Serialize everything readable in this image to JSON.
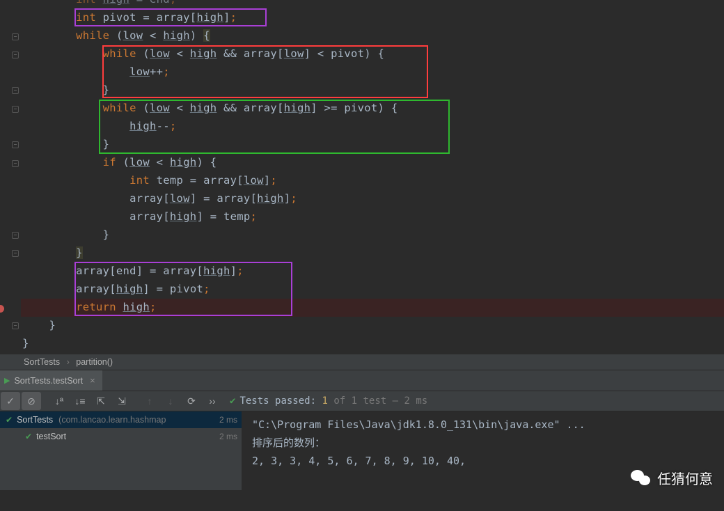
{
  "code": {
    "l1": "int high = end;",
    "l1_kw": "int ",
    "l1_var": "high",
    "l1_rest": " = end",
    "l2_kw": "int ",
    "l2_rest1": "pivot = array[",
    "l2_high": "high",
    "l2_rest2": "]",
    "l3_kw": "while ",
    "l3_rest1": "(",
    "l3_low": "low",
    "l3_rest2": " < ",
    "l3_high": "high",
    "l3_rest3": ") ",
    "l3_brace": "{",
    "l4_kw": "while ",
    "l4_rest1": "(",
    "l4_low": "low",
    "l4_rest2": " < ",
    "l4_high": "high",
    "l4_rest3": " && array[",
    "l4_low2": "low",
    "l4_rest4": "] < pivot) {",
    "l5_low": "low",
    "l5_rest": "++",
    "l6": "}",
    "l7_kw": "while ",
    "l7_rest1": "(",
    "l7_low": "low",
    "l7_rest2": " < ",
    "l7_high": "high",
    "l7_rest3": " && array[",
    "l7_high2": "high",
    "l7_rest4": "] >= pivot) {",
    "l8_high": "high",
    "l8_rest": "--",
    "l9": "}",
    "l10_kw": "if ",
    "l10_rest1": "(",
    "l10_low": "low",
    "l10_rest2": " < ",
    "l10_high": "high",
    "l10_rest3": ") {",
    "l11_kw": "int ",
    "l11_rest1": "temp = array[",
    "l11_low": "low",
    "l11_rest2": "]",
    "l12_rest1": "array[",
    "l12_low": "low",
    "l12_rest2": "] = array[",
    "l12_high": "high",
    "l12_rest3": "]",
    "l13_rest1": "array[",
    "l13_high": "high",
    "l13_rest2": "] = temp",
    "l14": "}",
    "l15": "}",
    "l16_rest1": "array[end] = array[",
    "l16_high": "high",
    "l16_rest2": "]",
    "l17_rest1": "array[",
    "l17_high": "high",
    "l17_rest2": "] = pivot",
    "l18_kw": "return ",
    "l18_high": "high",
    "l19": "}",
    "l20": "}"
  },
  "breadcrumb": {
    "class": "SortTests",
    "method": "partition()"
  },
  "runTab": {
    "label": "SortTests.testSort"
  },
  "testStatus": {
    "prefix": "Tests passed: ",
    "passed": "1",
    "middle": " of 1 test – ",
    "time": "2 ms"
  },
  "tree": {
    "root": "SortTests",
    "rootPkg": "(com.lancao.learn.hashmap",
    "rootDur": "2 ms",
    "child": "testSort",
    "childDur": "2 ms"
  },
  "console": {
    "l1": "\"C:\\Program Files\\Java\\jdk1.8.0_131\\bin\\java.exe\" ...",
    "l2": "",
    "l3": "排序后的数列：",
    "l4": "2, 3, 3, 4, 5, 6, 7, 8, 9, 10, 40, "
  },
  "watermark": "任猜何意"
}
